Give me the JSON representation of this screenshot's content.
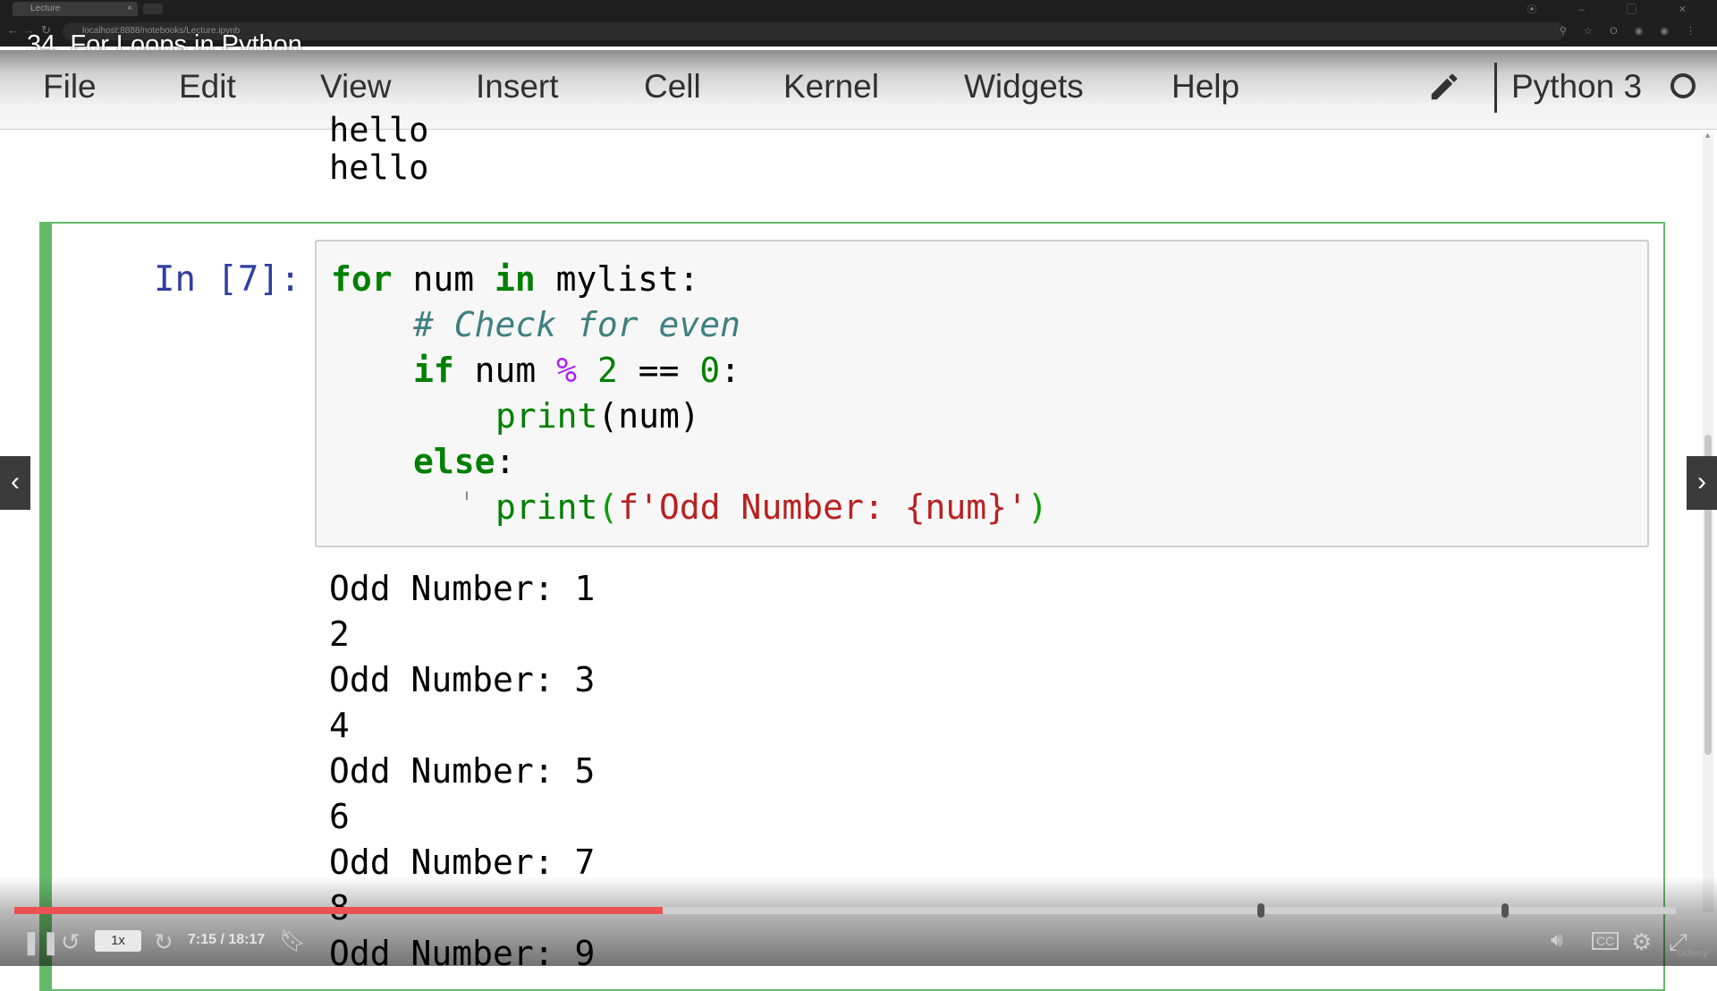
{
  "browser": {
    "tab_title": "Lecture",
    "tab_close": "×",
    "address": "localhost:8888/notebooks/Lecture.ipynb",
    "window_controls": "⦿ – ▢ ✕",
    "extension_icons": "⚲ ☆ O ◉ ◉ ⋮"
  },
  "video": {
    "lecture_title": "34. For Loops in Python",
    "speed": "1x",
    "time": "7:15 / 18:17",
    "progress": 0.39,
    "bookmarks": [
      0.75,
      0.897
    ],
    "brand": "Udemy"
  },
  "menu": {
    "items": [
      "File",
      "Edit",
      "View",
      "Insert",
      "Cell",
      "Kernel",
      "Widgets",
      "Help"
    ],
    "kernel_name": "Python 3"
  },
  "notebook": {
    "prev_output": [
      "hello",
      "hello"
    ],
    "cell": {
      "prompt": "In [7]:",
      "code": {
        "l1_kw": "for",
        "l1_a": " num ",
        "l1_kw2": "in",
        "l1_b": " mylist:",
        "l2_comment": "# Check for even",
        "l3_kw": "if",
        "l3_a": " num ",
        "l3_op": "%",
        "l3_num1": "2",
        "l3_eq": " == ",
        "l3_num2": "0",
        "l3_colon": ":",
        "l4_fn": "print",
        "l4_rest": "(num)",
        "l5_kw": "else",
        "l5_colon": ":",
        "l6_fn": "print",
        "l6_open": "(",
        "l6_prefix": "f",
        "l6_str1": "'Odd Number: ",
        "l6_brace": "{num}",
        "l6_str2": "'",
        "l6_close": ")"
      },
      "outputs": [
        "Odd Number: 1",
        "2",
        "Odd Number: 3",
        "4",
        "Odd Number: 5",
        "6",
        "Odd Number: 7",
        "8",
        "Odd Number: 9"
      ]
    }
  },
  "colors": {
    "cell_border": "#66bb6a",
    "prompt": "#303f9f",
    "keyword": "#008000",
    "string": "#ba2121",
    "operator": "#aa22ff",
    "progress": "#ec5252"
  }
}
